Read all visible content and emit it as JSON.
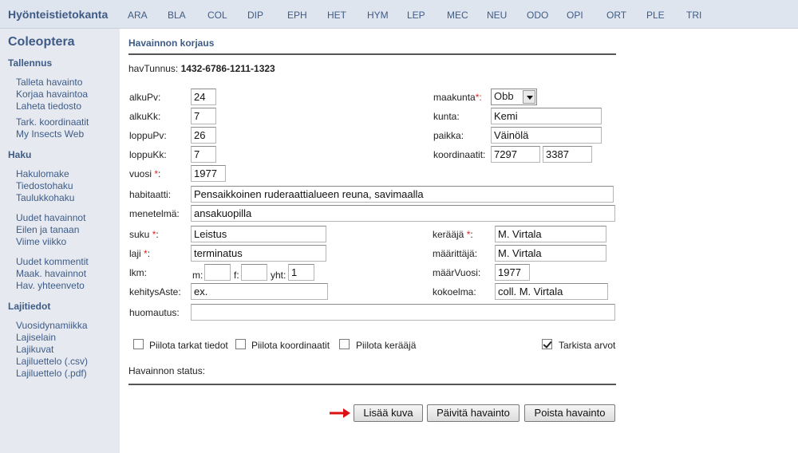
{
  "site_title": "Hyönteistietokanta",
  "nav": [
    "ARA",
    "BLA",
    "COL",
    "DIP",
    "EPH",
    "HET",
    "HYM",
    "LEP",
    "MEC",
    "NEU",
    "ODO",
    "OPI",
    "ORT",
    "PLE",
    "TRI"
  ],
  "sidebar": {
    "title": "Coleoptera",
    "sections": [
      {
        "heading": "Tallennus",
        "links": [
          "Talleta havainto",
          "Korjaa havaintoa",
          "Laheta tiedosto",
          "Tark. koordinaatit",
          "My Insects Web"
        ]
      },
      {
        "heading": "Haku",
        "links": [
          "Hakulomake",
          "Tiedostohaku",
          "Taulukkohaku",
          "Uudet havainnot",
          "Eilen ja tanaan",
          "Viime viikko",
          "Uudet kommentit",
          "Maak. havainnot",
          "Hav. yhteenveto"
        ]
      },
      {
        "heading": "Lajitiedot",
        "links": [
          "Vuosidynamiikka",
          "Lajiselain",
          "Lajikuvat",
          "Lajiluettelo (.csv)",
          "Lajiluettelo (.pdf)"
        ]
      }
    ]
  },
  "form": {
    "title": "Havainnon korjaus",
    "havtunnus_label": "havTunnus:",
    "havtunnus_value": "1432-6786-1211-1323",
    "labels": {
      "alkuPv": "alkuPv:",
      "alkuKk": "alkuKk:",
      "loppuPv": "loppuPv:",
      "loppuKk": "loppuKk:",
      "vuosi": "vuosi",
      "maakunta": "maakunta",
      "kunta": "kunta:",
      "paikka": "paikka:",
      "koordinaatit": "koordinaatit:",
      "habitaatti": "habitaatti:",
      "menetelma": "menetelmä:",
      "suku": "suku",
      "laji": "laji",
      "keraaja": "kerääjä",
      "maarittaja": "määrittäjä:",
      "lkm": "lkm:",
      "m": "m:",
      "f": "f:",
      "yht": "yht:",
      "maarVuosi": "määrVuosi:",
      "kehitysAste": "kehitysAste:",
      "kokoelma": "kokoelma:",
      "huomautus": "huomautus:",
      "req_star": "*",
      "req_colon": ":",
      "req_star_colon": "*:"
    },
    "values": {
      "alkuPv": "24",
      "alkuKk": "7",
      "loppuPv": "26",
      "loppuKk": "7",
      "vuosi": "1977",
      "maakunta": "Obb",
      "kunta": "Kemi",
      "paikka": "Väinölä",
      "koord1": "7297",
      "koord2": "3387",
      "habitaatti": "Pensaikkoinen ruderaattialueen reuna, savimaalla",
      "menetelma": "ansakuopilla",
      "suku": "Leistus",
      "laji": "terminatus",
      "keraaja": "M. Virtala",
      "maarittaja": "M. Virtala",
      "m": "",
      "f": "",
      "yht": "1",
      "maarVuosi": "1977",
      "kehitysAste": "ex.",
      "kokoelma": "coll. M. Virtala",
      "huomautus": ""
    },
    "checkboxes": {
      "piilota_tarkat": {
        "label": "Piilota tarkat tiedot",
        "checked": false
      },
      "piilota_koord": {
        "label": "Piilota koordinaatit",
        "checked": false
      },
      "piilota_keraaja": {
        "label": "Piilota kerääjä",
        "checked": false
      },
      "tarkista": {
        "label": "Tarkista arvot",
        "checked": true
      }
    },
    "status_label": "Havainnon status:",
    "buttons": {
      "lisaa_kuva": "Lisää kuva",
      "paivita": "Päivitä havainto",
      "poista": "Poista havainto"
    }
  },
  "colors": {
    "accent": "#3e5b86",
    "required": "#dd2222",
    "arrow": "#dd1111"
  }
}
